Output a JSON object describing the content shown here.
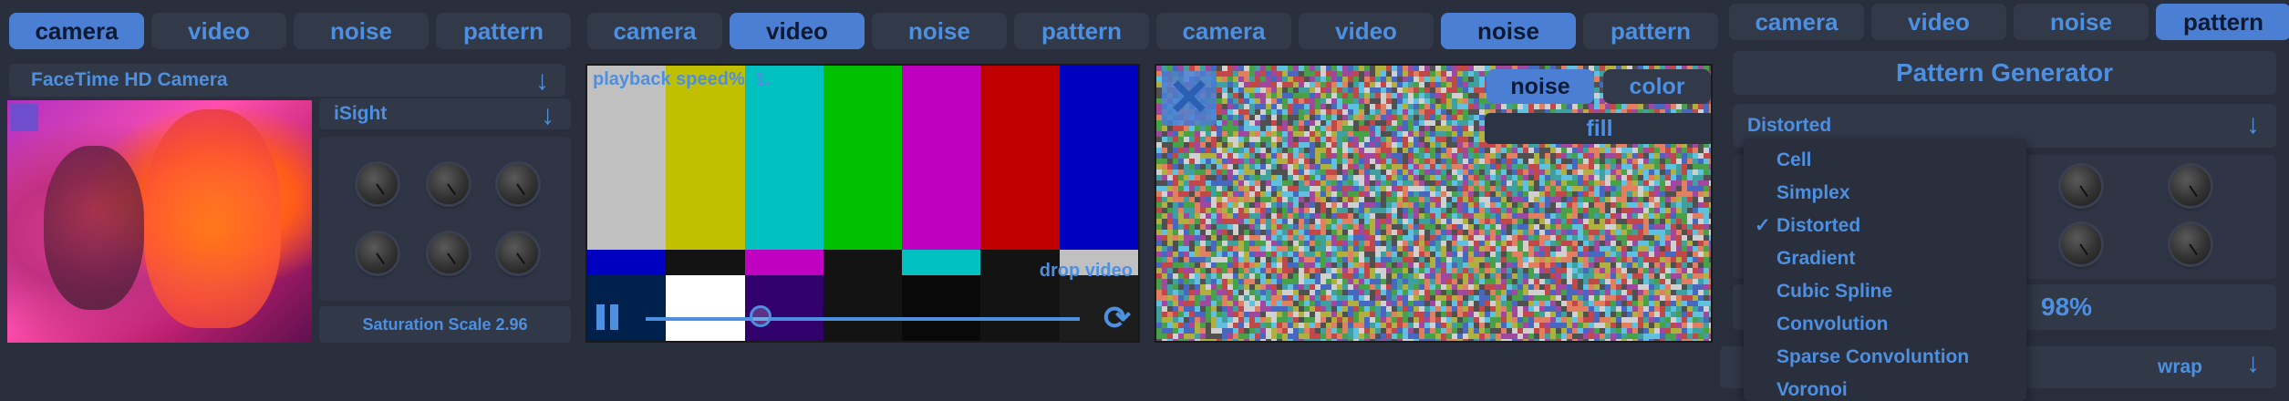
{
  "tabs_labels": [
    "camera",
    "video",
    "noise",
    "pattern"
  ],
  "panel1": {
    "active_tab": 0,
    "camera_select": "FaceTime HD Camera",
    "source_select": "iSight",
    "saturation": "Saturation Scale 2.96",
    "arrow": "↓"
  },
  "panel2": {
    "active_tab": 1,
    "speed_label": "playback speed%  1.",
    "drop_label": "drop video",
    "playback_progress": 0.24,
    "colors_top": [
      "#c0c0c0",
      "#c0c000",
      "#00c0c0",
      "#00c000",
      "#c000c0",
      "#c00000",
      "#0000c0"
    ],
    "colors_mid": [
      "#0000c0",
      "#131313",
      "#c000c0",
      "#131313",
      "#00c0c0",
      "#131313",
      "#c0c0c0"
    ],
    "colors_bottom": [
      "#00214c",
      "#ffffff",
      "#32006a",
      "#131313",
      "#090909",
      "#131313",
      "#1d1d1d"
    ]
  },
  "panel3": {
    "active_tab": 2,
    "noise_btn": "noise",
    "color_btn": "color",
    "fill_btn": "fill"
  },
  "panel4": {
    "active_tab": 3,
    "title": "Pattern Generator",
    "select_value": "Distorted",
    "menu_items": [
      "Cell",
      "Simplex",
      "Distorted",
      "Gradient",
      "Cubic Spline",
      "Convolution",
      "Sparse Convoluntion",
      "Voronoi"
    ],
    "checked_index": 2,
    "check_mark": "✓",
    "percent": "98%",
    "wrap": "wrap",
    "arrow": "↓"
  }
}
